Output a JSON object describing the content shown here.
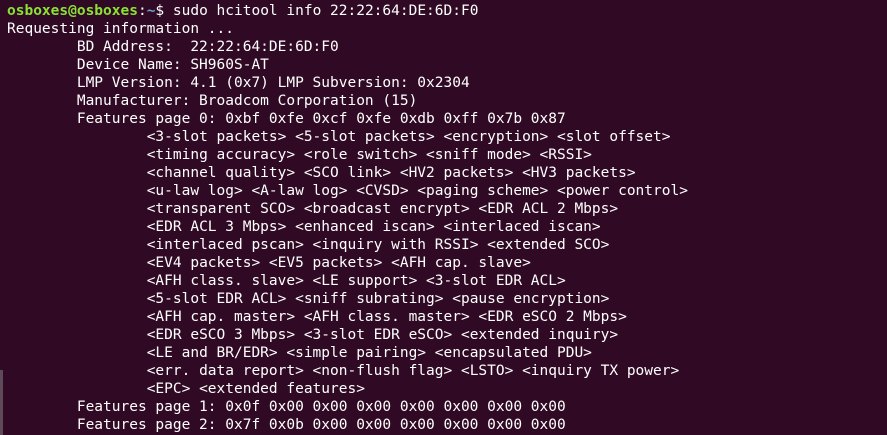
{
  "colors": {
    "background": "#300a24",
    "text": "#ffffff",
    "prompt_user": "#8ae234",
    "prompt_path": "#729fcf"
  },
  "prompt": {
    "user_host": "osboxes@osboxes",
    "separator": ":",
    "path": "~",
    "symbol": "$ ",
    "command": "sudo hcitool info 22:22:64:DE:6D:F0"
  },
  "output": [
    "Requesting information ...",
    "\tBD Address:  22:22:64:DE:6D:F0",
    "\tDevice Name: SH960S-AT",
    "\tLMP Version: 4.1 (0x7) LMP Subversion: 0x2304",
    "\tManufacturer: Broadcom Corporation (15)",
    "\tFeatures page 0: 0xbf 0xfe 0xcf 0xfe 0xdb 0xff 0x7b 0x87",
    "\t\t<3-slot packets> <5-slot packets> <encryption> <slot offset>",
    "\t\t<timing accuracy> <role switch> <sniff mode> <RSSI>",
    "\t\t<channel quality> <SCO link> <HV2 packets> <HV3 packets>",
    "\t\t<u-law log> <A-law log> <CVSD> <paging scheme> <power control>",
    "\t\t<transparent SCO> <broadcast encrypt> <EDR ACL 2 Mbps>",
    "\t\t<EDR ACL 3 Mbps> <enhanced iscan> <interlaced iscan>",
    "\t\t<interlaced pscan> <inquiry with RSSI> <extended SCO>",
    "\t\t<EV4 packets> <EV5 packets> <AFH cap. slave>",
    "\t\t<AFH class. slave> <LE support> <3-slot EDR ACL>",
    "\t\t<5-slot EDR ACL> <sniff subrating> <pause encryption>",
    "\t\t<AFH cap. master> <AFH class. master> <EDR eSCO 2 Mbps>",
    "\t\t<EDR eSCO 3 Mbps> <3-slot EDR eSCO> <extended inquiry>",
    "\t\t<LE and BR/EDR> <simple pairing> <encapsulated PDU>",
    "\t\t<err. data report> <non-flush flag> <LSTO> <inquiry TX power>",
    "\t\t<EPC> <extended features>",
    "\tFeatures page 1: 0x0f 0x00 0x00 0x00 0x00 0x00 0x00 0x00",
    "\tFeatures page 2: 0x7f 0x0b 0x00 0x00 0x00 0x00 0x00 0x00"
  ]
}
